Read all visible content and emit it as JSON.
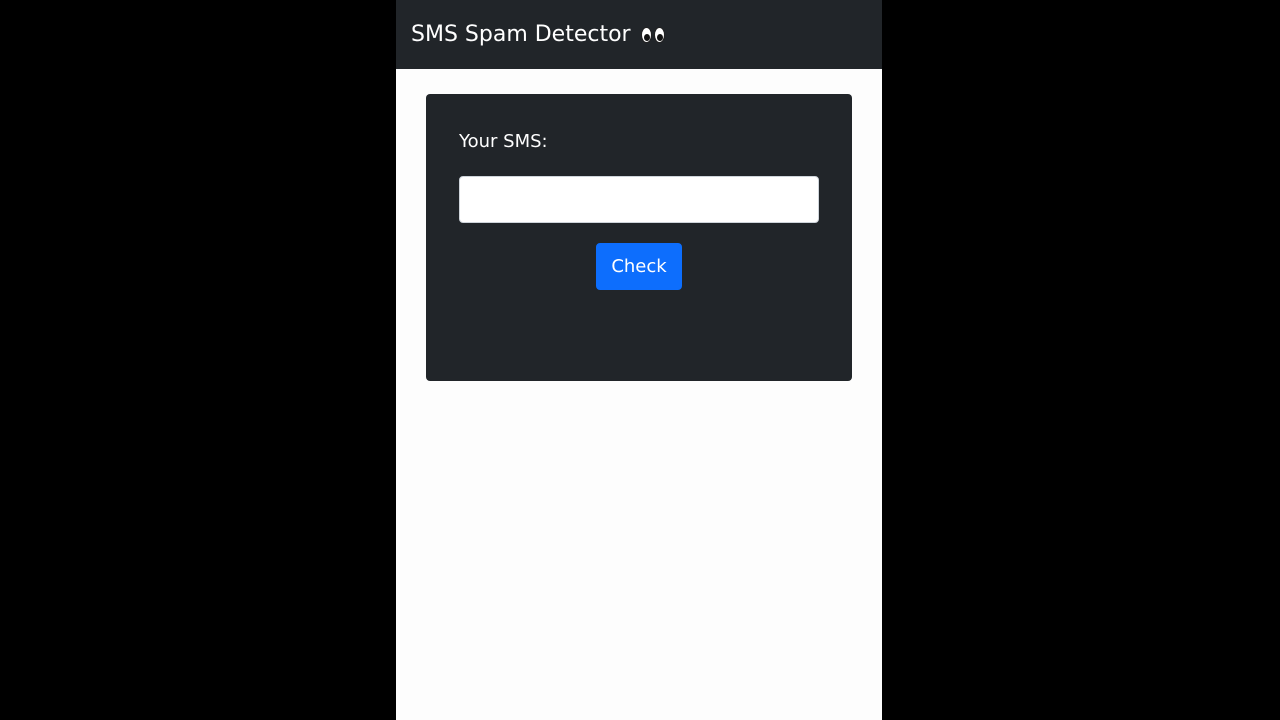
{
  "navbar": {
    "title": "SMS Spam Detector",
    "emoji_icon": "eyes-emoji"
  },
  "form": {
    "label": "Your SMS:",
    "input_value": "",
    "input_placeholder": "",
    "button_label": "Check"
  },
  "colors": {
    "navbar_bg": "#212529",
    "card_bg": "#212529",
    "page_bg": "#fdfdfd",
    "outer_bg": "#000000",
    "button_bg": "#0d6efd",
    "text": "#ffffff"
  }
}
